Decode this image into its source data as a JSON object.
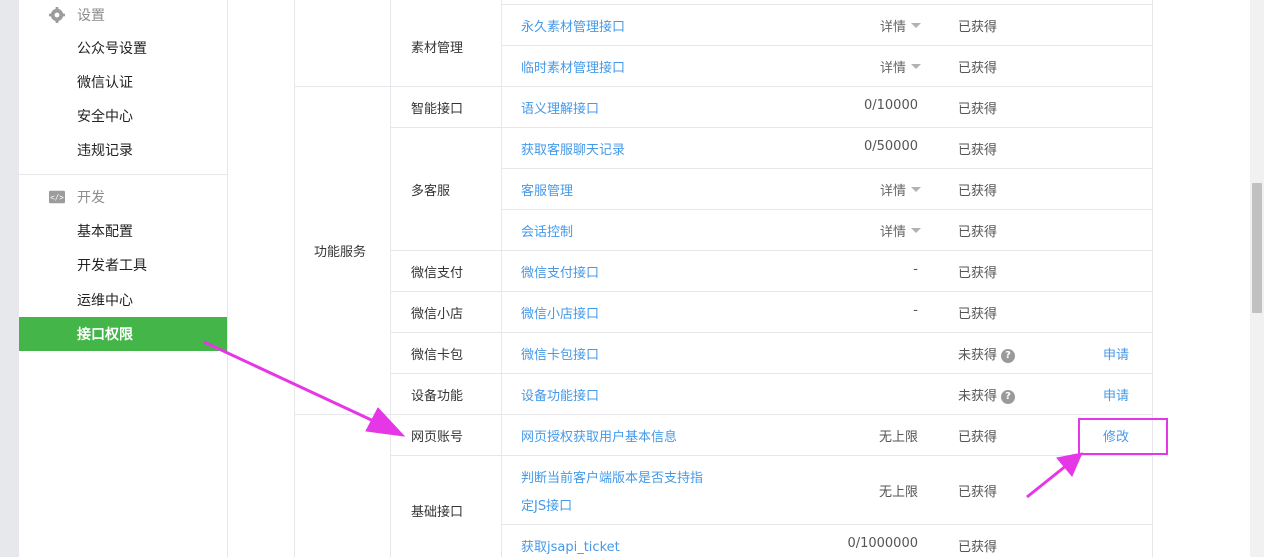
{
  "sidebar": {
    "settings_section": {
      "title": "设置",
      "icon": "gear-icon"
    },
    "settings_items": [
      {
        "label": "公众号设置"
      },
      {
        "label": "微信认证"
      },
      {
        "label": "安全中心"
      },
      {
        "label": "违规记录"
      }
    ],
    "dev_section": {
      "title": "开发",
      "icon": "code-icon"
    },
    "dev_items": [
      {
        "label": "基本配置"
      },
      {
        "label": "开发者工具"
      },
      {
        "label": "运维中心"
      },
      {
        "label": "接口权限",
        "active": true
      }
    ]
  },
  "table": {
    "categories": [
      {
        "label": "功能服务"
      },
      {
        "label": ""
      }
    ],
    "subgroups": [
      {
        "label": "素材管理"
      },
      {
        "label": "智能接口"
      },
      {
        "label": "多客服"
      },
      {
        "label": "微信支付"
      },
      {
        "label": "微信小店"
      },
      {
        "label": "微信卡包"
      },
      {
        "label": "设备功能"
      },
      {
        "label": "网页账号"
      },
      {
        "label": "基础接口"
      }
    ],
    "rows": [
      {
        "name": "永久素材管理接口",
        "quota": "详情",
        "status": "已获得",
        "action": ""
      },
      {
        "name": "临时素材管理接口",
        "quota": "详情",
        "status": "已获得",
        "action": ""
      },
      {
        "name": "语义理解接口",
        "quota": "0/10000",
        "status": "已获得",
        "action": ""
      },
      {
        "name": "获取客服聊天记录",
        "quota": "0/50000",
        "status": "已获得",
        "action": ""
      },
      {
        "name": "客服管理",
        "quota": "详情",
        "status": "已获得",
        "action": ""
      },
      {
        "name": "会话控制",
        "quota": "详情",
        "status": "已获得",
        "action": ""
      },
      {
        "name": "微信支付接口",
        "quota": "-",
        "status": "已获得",
        "action": ""
      },
      {
        "name": "微信小店接口",
        "quota": "-",
        "status": "已获得",
        "action": ""
      },
      {
        "name": "微信卡包接口",
        "quota": "",
        "status": "未获得",
        "action": "申请"
      },
      {
        "name": "设备功能接口",
        "quota": "",
        "status": "未获得",
        "action": "申请"
      },
      {
        "name": "网页授权获取用户基本信息",
        "quota": "无上限",
        "status": "已获得",
        "action": "修改"
      },
      {
        "name_line1": "判断当前客户端版本是否支持指",
        "name_line2": "定JS接口",
        "quota": "无上限",
        "status": "已获得",
        "action": ""
      },
      {
        "name": "获取jsapi_ticket",
        "quota": "0/1000000",
        "status": "已获得",
        "action": ""
      }
    ]
  },
  "colors": {
    "accent_green": "#44b549",
    "link_blue": "#459ae9",
    "annotation_magenta": "#e637e6"
  }
}
